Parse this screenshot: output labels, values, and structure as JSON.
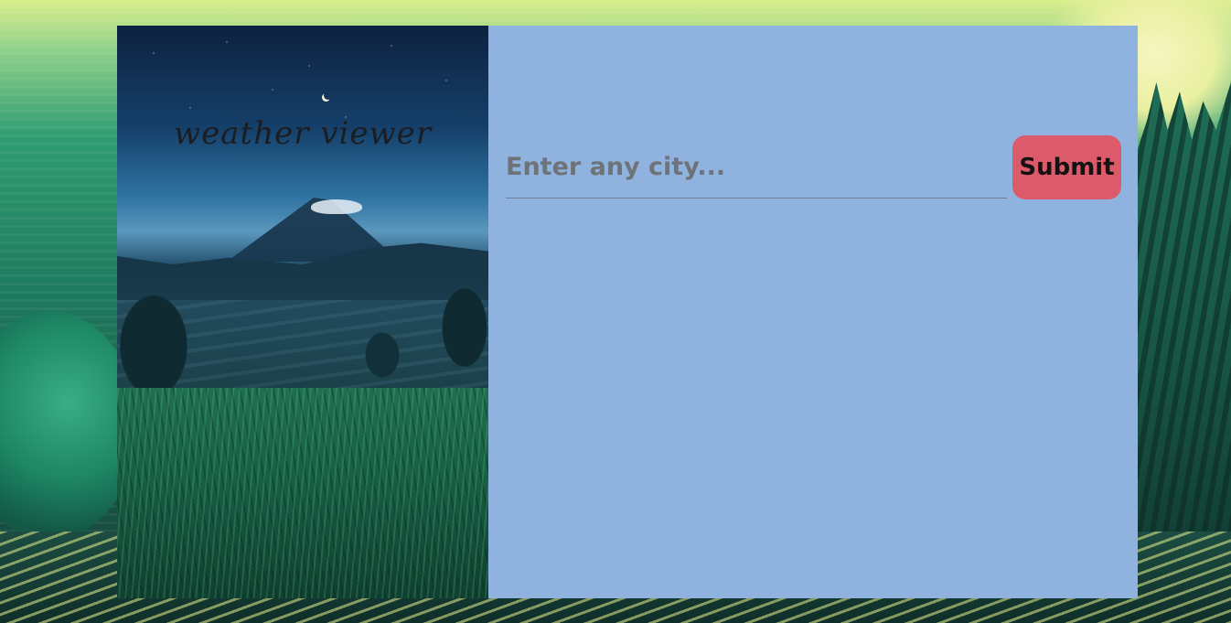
{
  "app": {
    "title": "weather viewer"
  },
  "search": {
    "placeholder": "Enter any city...",
    "value": ""
  },
  "actions": {
    "submit_label": "Submit"
  },
  "colors": {
    "form_panel_bg": "#8fb3de",
    "submit_bg": "#dc5b6a",
    "input_border": "#6c7f96"
  }
}
